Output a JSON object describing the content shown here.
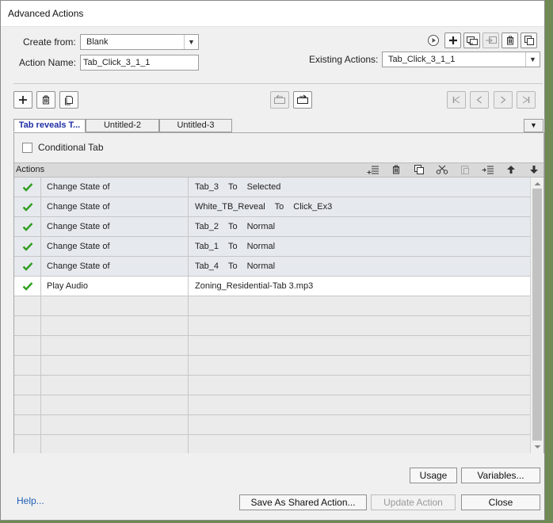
{
  "window": {
    "title": "Advanced Actions"
  },
  "form": {
    "create_from_label": "Create from:",
    "create_from_value": "Blank",
    "action_name_label": "Action Name:",
    "action_name_value": "Tab_Click_3_1_1",
    "existing_actions_label": "Existing Actions:",
    "existing_actions_value": "Tab_Click_3_1_1"
  },
  "tabs": [
    {
      "label": "Tab reveals T...",
      "active": true
    },
    {
      "label": "Untitled-2",
      "active": false
    },
    {
      "label": "Untitled-3",
      "active": false
    }
  ],
  "conditional_tab": {
    "label": "Conditional Tab",
    "checked": false
  },
  "actions_header": "Actions",
  "actions": [
    {
      "status": "check-icon",
      "action": "Change State of",
      "target": "Tab_3",
      "connector": "To",
      "value": "Selected"
    },
    {
      "status": "check-icon",
      "action": "Change State of",
      "target": "White_TB_Reveal",
      "connector": "To",
      "value": "Click_Ex3"
    },
    {
      "status": "check-icon",
      "action": "Change State of",
      "target": "Tab_2",
      "connector": "To",
      "value": "Normal"
    },
    {
      "status": "check-icon",
      "action": "Change State of",
      "target": "Tab_1",
      "connector": "To",
      "value": "Normal"
    },
    {
      "status": "check-icon",
      "action": "Change State of",
      "target": "Tab_4",
      "connector": "To",
      "value": "Normal"
    },
    {
      "status": "check-icon",
      "action": "Play Audio",
      "target": "Zoning_Residential-Tab 3.mp3",
      "connector": "",
      "value": ""
    }
  ],
  "buttons": {
    "usage": "Usage",
    "variables": "Variables...",
    "help": "Help...",
    "save_shared": "Save As Shared Action...",
    "update_action": "Update Action",
    "close": "Close"
  },
  "colors": {
    "accent_tab_text": "#1f2fa4",
    "check_green": "#2e9e1f",
    "link_blue": "#1e5fb5"
  }
}
